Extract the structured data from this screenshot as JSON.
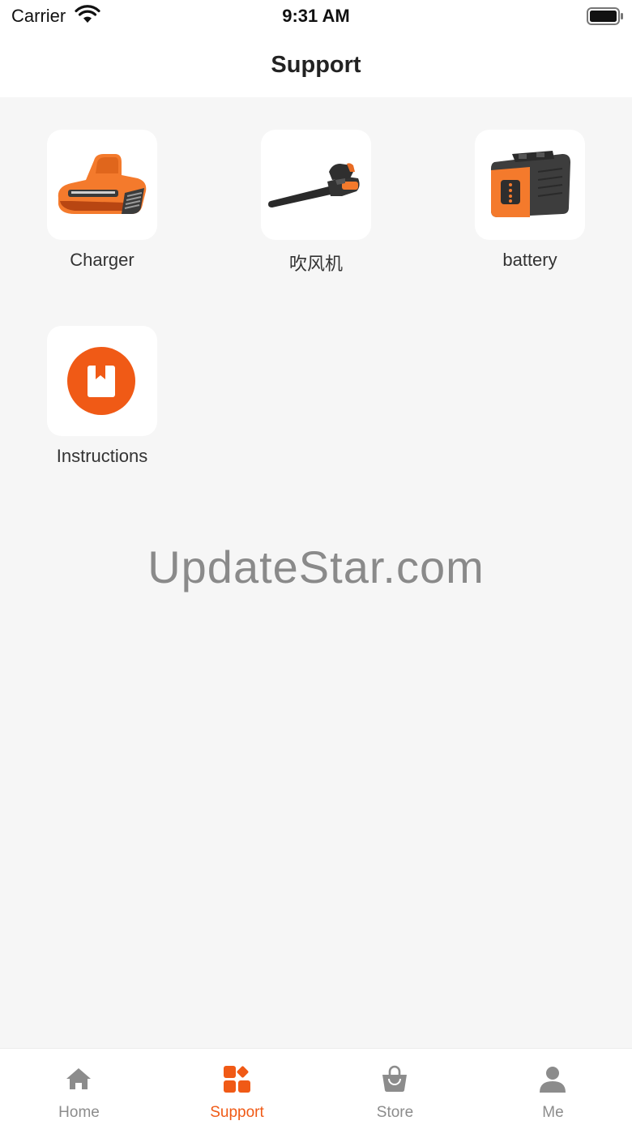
{
  "status_bar": {
    "carrier": "Carrier",
    "time": "9:31 AM"
  },
  "header": {
    "title": "Support"
  },
  "products": [
    {
      "label": "Charger",
      "icon": "charger-image"
    },
    {
      "label": "吹风机",
      "icon": "leaf-blower-image"
    },
    {
      "label": "battery",
      "icon": "battery-pack-image"
    },
    {
      "label": "Instructions",
      "icon": "manual-bookmark-icon"
    }
  ],
  "watermark": "UpdateStar.com",
  "tabs": [
    {
      "label": "Home",
      "icon": "home-icon",
      "active": false
    },
    {
      "label": "Support",
      "icon": "support-grid-icon",
      "active": true
    },
    {
      "label": "Store",
      "icon": "shopping-bag-icon",
      "active": false
    },
    {
      "label": "Me",
      "icon": "person-icon",
      "active": false
    }
  ],
  "colors": {
    "accent": "#f05a16",
    "inactive_tab": "#8c8c8c",
    "background": "#f6f6f6"
  }
}
